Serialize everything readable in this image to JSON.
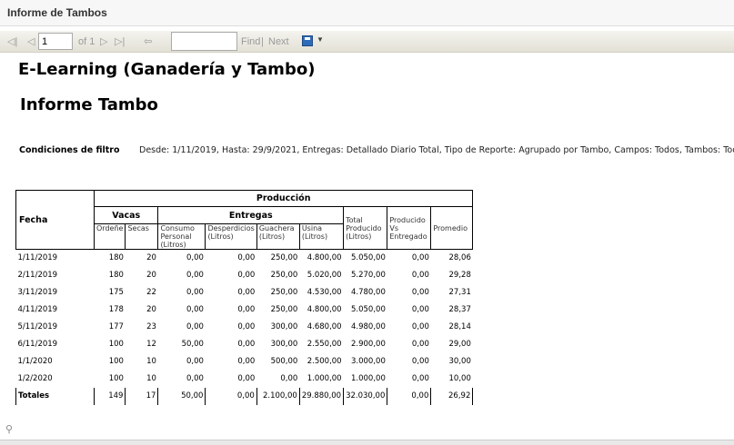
{
  "window": {
    "title": "Informe de Tambos"
  },
  "toolbar": {
    "first": "◁|",
    "prev": "◁",
    "page_value": "1",
    "of_pages": "of 1",
    "next": "▷",
    "last": "▷|",
    "back": "⇦",
    "find_value": "",
    "find_label": "Find",
    "separator": "|",
    "next_label": "Next",
    "export_icon": "save-disk-icon"
  },
  "report": {
    "title": "E-Learning (Ganadería y Tambo)",
    "subtitle": "Informe Tambo",
    "filter_label": "Condiciones de filtro",
    "filter_text": "Desde: 1/11/2019, Hasta: 29/9/2021, Entregas: Detallado Diario Total, Tipo de Reporte: Agrupado por Tambo, Campos: Todos, Tambos: Todos"
  },
  "table": {
    "col_fecha": "Fecha",
    "group_produccion": "Producción",
    "group_vacas": "Vacas",
    "group_entregas": "Entregas",
    "sub": {
      "ordene": "Ordeñe",
      "secas": "Secas",
      "consumo": "Consumo Personal (Litros)",
      "desperdicios": "Desperdicios (Litros)",
      "guachera": "Guachera (Litros)",
      "usina": "Usina (Litros)",
      "total": "Total Producido (Litros)",
      "producido_vs": "Producido Vs Entregado",
      "promedio": "Promedio"
    },
    "rows": [
      {
        "fecha": "1/11/2019",
        "ordene": "180",
        "secas": "20",
        "consumo": "0,00",
        "desperdicios": "0,00",
        "guachera": "250,00",
        "usina": "4.800,00",
        "total": "5.050,00",
        "vs": "0,00",
        "promedio": "28,06"
      },
      {
        "fecha": "2/11/2019",
        "ordene": "180",
        "secas": "20",
        "consumo": "0,00",
        "desperdicios": "0,00",
        "guachera": "250,00",
        "usina": "5.020,00",
        "total": "5.270,00",
        "vs": "0,00",
        "promedio": "29,28"
      },
      {
        "fecha": "3/11/2019",
        "ordene": "175",
        "secas": "22",
        "consumo": "0,00",
        "desperdicios": "0,00",
        "guachera": "250,00",
        "usina": "4.530,00",
        "total": "4.780,00",
        "vs": "0,00",
        "promedio": "27,31"
      },
      {
        "fecha": "4/11/2019",
        "ordene": "178",
        "secas": "20",
        "consumo": "0,00",
        "desperdicios": "0,00",
        "guachera": "250,00",
        "usina": "4.800,00",
        "total": "5.050,00",
        "vs": "0,00",
        "promedio": "28,37"
      },
      {
        "fecha": "5/11/2019",
        "ordene": "177",
        "secas": "23",
        "consumo": "0,00",
        "desperdicios": "0,00",
        "guachera": "300,00",
        "usina": "4.680,00",
        "total": "4.980,00",
        "vs": "0,00",
        "promedio": "28,14"
      },
      {
        "fecha": "6/11/2019",
        "ordene": "100",
        "secas": "12",
        "consumo": "50,00",
        "desperdicios": "0,00",
        "guachera": "300,00",
        "usina": "2.550,00",
        "total": "2.900,00",
        "vs": "0,00",
        "promedio": "29,00"
      },
      {
        "fecha": "1/1/2020",
        "ordene": "100",
        "secas": "10",
        "consumo": "0,00",
        "desperdicios": "0,00",
        "guachera": "500,00",
        "usina": "2.500,00",
        "total": "3.000,00",
        "vs": "0,00",
        "promedio": "30,00"
      },
      {
        "fecha": "1/2/2020",
        "ordene": "100",
        "secas": "10",
        "consumo": "0,00",
        "desperdicios": "0,00",
        "guachera": "0,00",
        "usina": "1.000,00",
        "total": "1.000,00",
        "vs": "0,00",
        "promedio": "10,00"
      }
    ],
    "totals": {
      "label": "Totales",
      "ordene": "149",
      "secas": "17",
      "consumo": "50,00",
      "desperdicios": "0,00",
      "guachera": "2.100,00",
      "usina": "29.880,00",
      "total": "32.030,00",
      "vs": "0,00",
      "promedio": "26,92"
    }
  },
  "footer": {
    "corner_icon": "pin-icon",
    "corner_glyph": "⚲"
  }
}
